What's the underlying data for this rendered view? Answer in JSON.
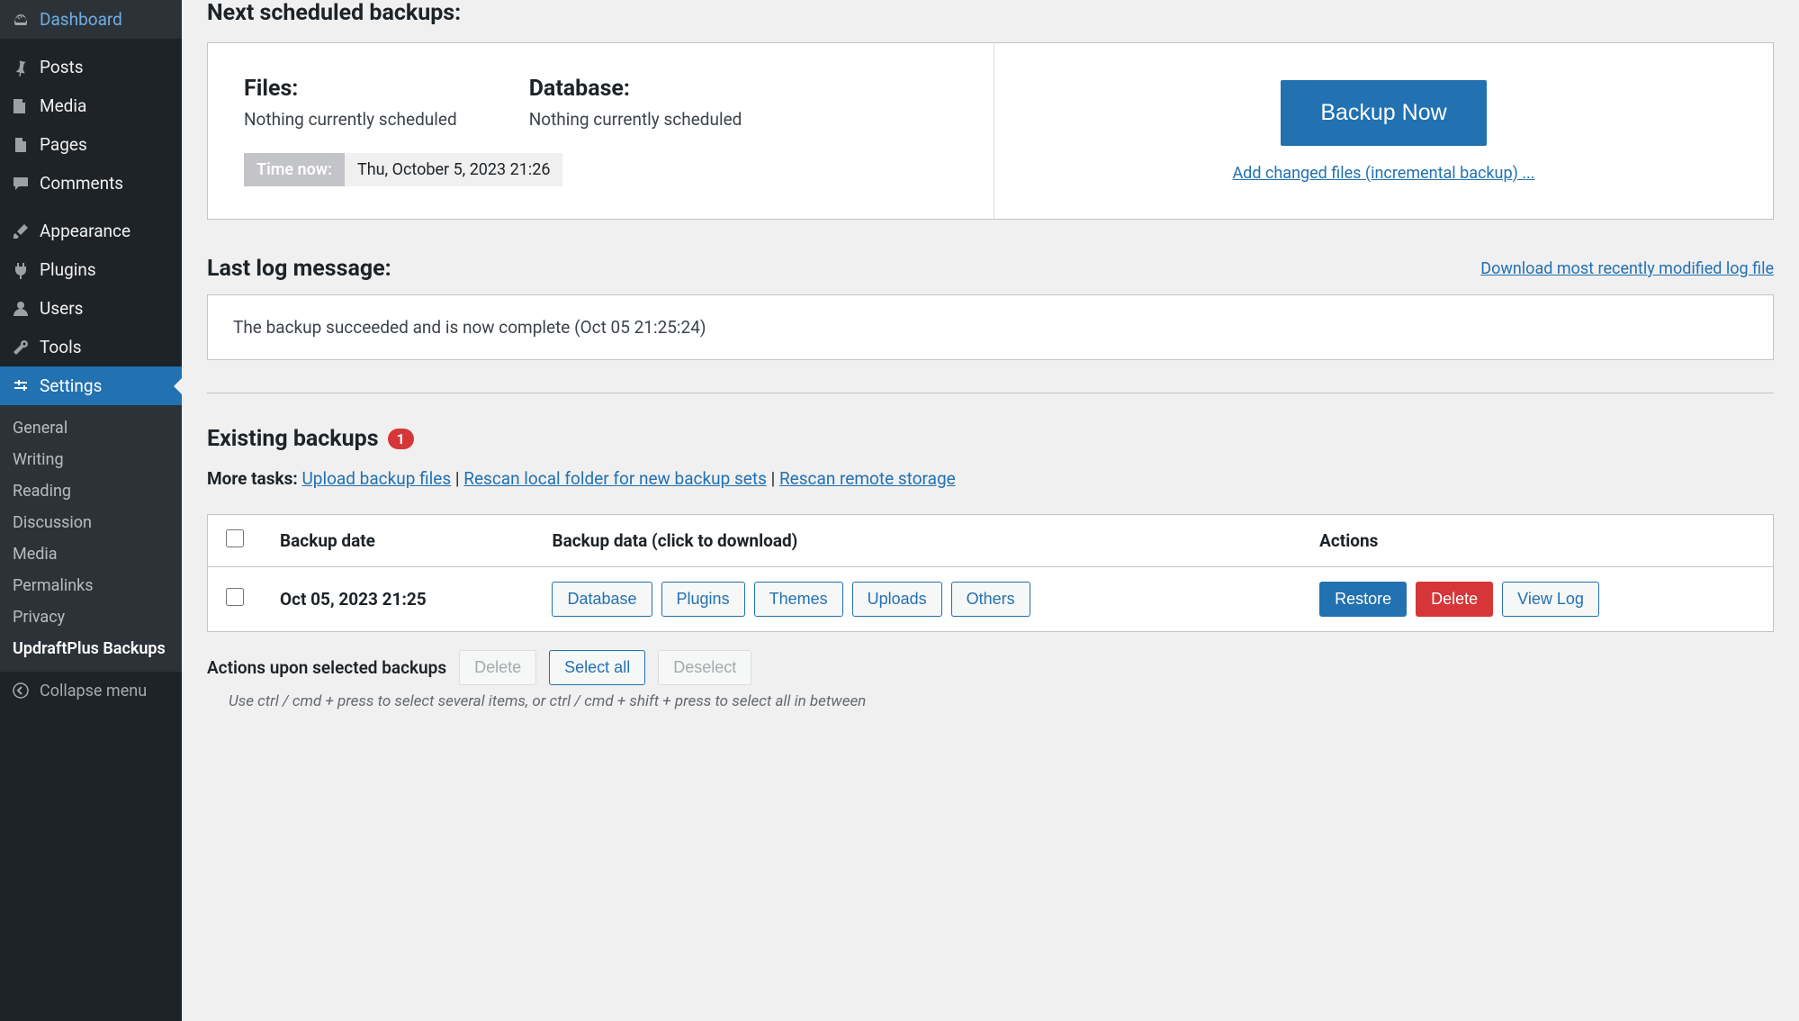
{
  "sidebar": {
    "items": [
      {
        "label": "Dashboard",
        "slug": "dashboard"
      },
      {
        "label": "Posts",
        "slug": "posts"
      },
      {
        "label": "Media",
        "slug": "media"
      },
      {
        "label": "Pages",
        "slug": "pages"
      },
      {
        "label": "Comments",
        "slug": "comments"
      },
      {
        "label": "Appearance",
        "slug": "appearance"
      },
      {
        "label": "Plugins",
        "slug": "plugins"
      },
      {
        "label": "Users",
        "slug": "users"
      },
      {
        "label": "Tools",
        "slug": "tools"
      },
      {
        "label": "Settings",
        "slug": "settings"
      }
    ],
    "submenu": {
      "items": [
        {
          "label": "General"
        },
        {
          "label": "Writing"
        },
        {
          "label": "Reading"
        },
        {
          "label": "Discussion"
        },
        {
          "label": "Media"
        },
        {
          "label": "Permalinks"
        },
        {
          "label": "Privacy"
        },
        {
          "label": "UpdraftPlus Backups"
        }
      ]
    },
    "collapse_label": "Collapse menu"
  },
  "scheduled": {
    "title": "Next scheduled backups:",
    "files_label": "Files:",
    "files_status": "Nothing currently scheduled",
    "db_label": "Database:",
    "db_status": "Nothing currently scheduled",
    "time_label": "Time now:",
    "time_value": "Thu, October 5, 2023 21:26",
    "backup_now": "Backup Now",
    "incremental_link": "Add changed files (incremental backup) ..."
  },
  "log": {
    "title": "Last log message:",
    "download_link": "Download most recently modified log file",
    "message": "The backup succeeded and is now complete (Oct 05 21:25:24)"
  },
  "existing": {
    "title": "Existing backups",
    "badge": "1",
    "more_tasks_label": "More tasks:",
    "upload_link": "Upload backup files",
    "rescan_local_link": "Rescan local folder for new backup sets",
    "rescan_remote_link": "Rescan remote storage"
  },
  "table": {
    "headers": {
      "date": "Backup date",
      "data": "Backup data (click to download)",
      "actions": "Actions"
    },
    "row": {
      "date": "Oct 05, 2023 21:25",
      "data_buttons": [
        "Database",
        "Plugins",
        "Themes",
        "Uploads",
        "Others"
      ],
      "restore": "Restore",
      "delete": "Delete",
      "viewlog": "View Log"
    }
  },
  "bulk": {
    "label": "Actions upon selected backups",
    "delete": "Delete",
    "select_all": "Select all",
    "deselect": "Deselect",
    "hint": "Use ctrl / cmd + press to select several items, or ctrl / cmd + shift + press to select all in between"
  }
}
